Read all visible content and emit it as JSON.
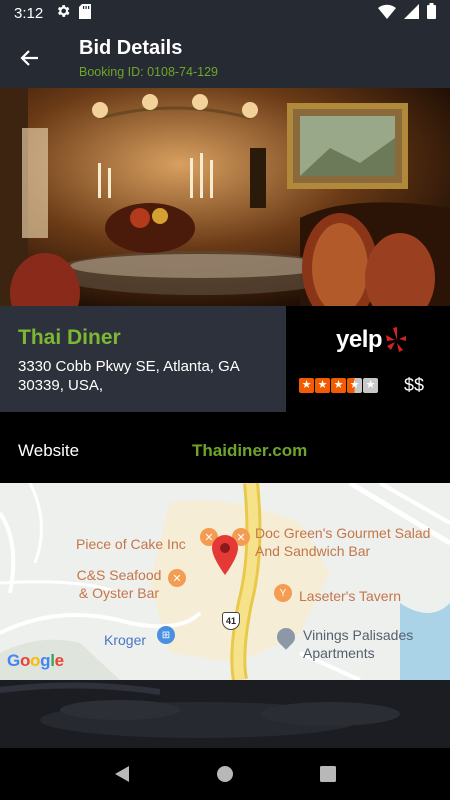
{
  "status": {
    "time": "3:12"
  },
  "header": {
    "title": "Bid Details",
    "booking_id": "Booking ID: 0108-74-129"
  },
  "venue": {
    "name": "Thai Diner",
    "address": "3330 Cobb Pkwy SE, Atlanta, GA 30339, USA,",
    "rating_stars": 3.5,
    "price": "$$",
    "yelp_label": "yelp"
  },
  "website": {
    "label": "Website",
    "link": "Thaidiner.com"
  },
  "map": {
    "places": [
      {
        "name": "Piece of Cake Inc"
      },
      {
        "name": "Doc Green's Gourmet Salad And Sandwich Bar"
      },
      {
        "name": "C&S Seafood & Oyster Bar"
      },
      {
        "name": "Laseter's Tavern"
      },
      {
        "name": "Kroger"
      },
      {
        "name": "Vinings Palisades Apartments"
      }
    ],
    "route_shield": "41",
    "attribution": "Google"
  },
  "colors": {
    "accent_green": "#6fa52b",
    "yelp_red": "#d32323",
    "star_orange": "#f15c00",
    "bar_bg": "#262a33"
  }
}
